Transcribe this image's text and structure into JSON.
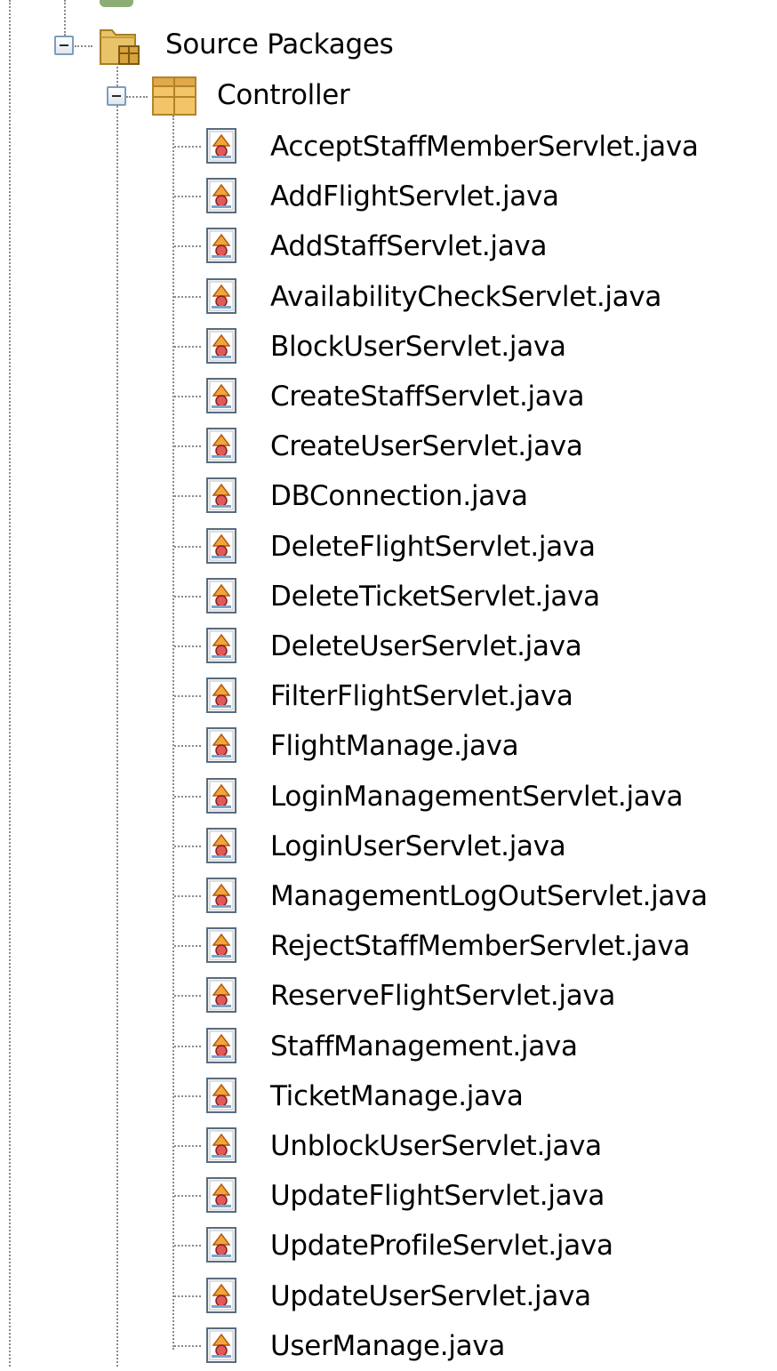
{
  "tree": {
    "source_packages": {
      "label": "Source Packages",
      "icon": "source-packages-folder-icon",
      "expanded": true
    },
    "package": {
      "label": "Controller",
      "icon": "package-icon",
      "expanded": true
    },
    "file_icon": "java-class-file-icon",
    "files": [
      "AcceptStaffMemberServlet.java",
      "AddFlightServlet.java",
      "AddStaffServlet.java",
      "AvailabilityCheckServlet.java",
      "BlockUserServlet.java",
      "CreateStaffServlet.java",
      "CreateUserServlet.java",
      "DBConnection.java",
      "DeleteFlightServlet.java",
      "DeleteTicketServlet.java",
      "DeleteUserServlet.java",
      "FilterFlightServlet.java",
      "FlightManage.java",
      "LoginManagementServlet.java",
      "LoginUserServlet.java",
      "ManagementLogOutServlet.java",
      "RejectStaffMemberServlet.java",
      "ReserveFlightServlet.java",
      "StaffManagement.java",
      "TicketManage.java",
      "UnblockUserServlet.java",
      "UpdateFlightServlet.java",
      "UpdateProfileServlet.java",
      "UpdateUserServlet.java",
      "UserManage.java"
    ]
  }
}
